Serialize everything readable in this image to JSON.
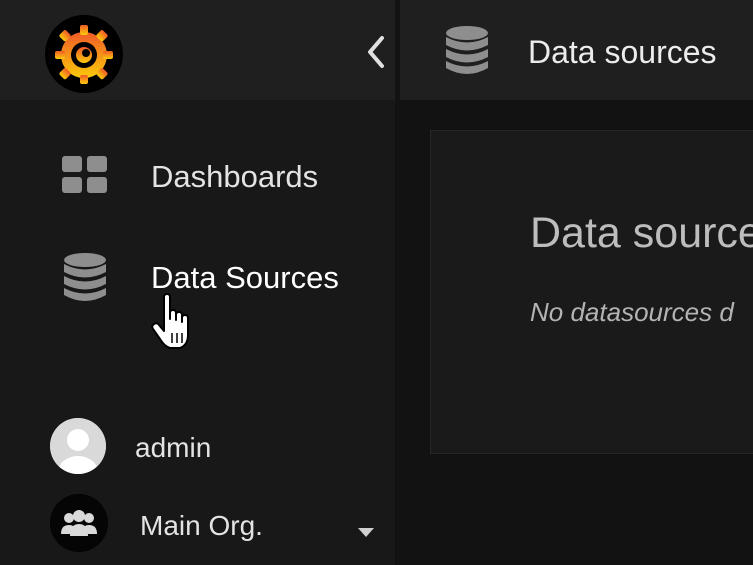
{
  "sidebar": {
    "logo_icon": "grafana-logo-icon",
    "collapse_icon": "chevron-left-icon",
    "items": [
      {
        "label": "Dashboards",
        "icon": "grid-icon",
        "active": false
      },
      {
        "label": "Data Sources",
        "icon": "database-icon",
        "active": true
      }
    ],
    "user": {
      "name": "admin",
      "icon": "user-avatar-icon"
    },
    "org": {
      "name": "Main Org.",
      "icon": "users-group-icon",
      "caret_icon": "caret-down-icon"
    }
  },
  "topbar": {
    "icon": "database-icon",
    "title": "Data sources"
  },
  "main": {
    "panel_title": "Data source",
    "empty_message": "No datasources d"
  },
  "colors": {
    "background": "#121212",
    "sidebar": "#181818",
    "header": "#1f1f1f",
    "text": "#e3e3e3",
    "muted": "#bdbdbd"
  }
}
